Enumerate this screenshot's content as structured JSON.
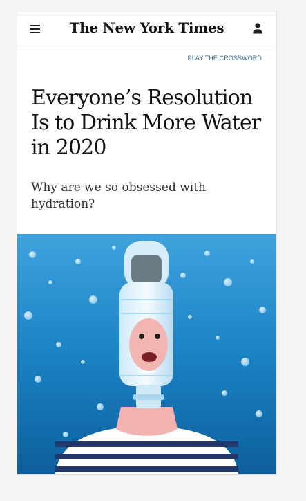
{
  "header": {
    "masthead": "The New York Times",
    "menu_icon": "hamburger-menu-icon",
    "account_icon": "user-account-icon"
  },
  "promo": {
    "crossword_link": "PLAY THE CROSSWORD"
  },
  "article": {
    "headline": "Everyone’s Resolution Is to Drink More Water in 2020",
    "summary": "Why are we so obsessed with hydration?"
  },
  "colors": {
    "link": "#326891",
    "water": "#1b82c4"
  }
}
